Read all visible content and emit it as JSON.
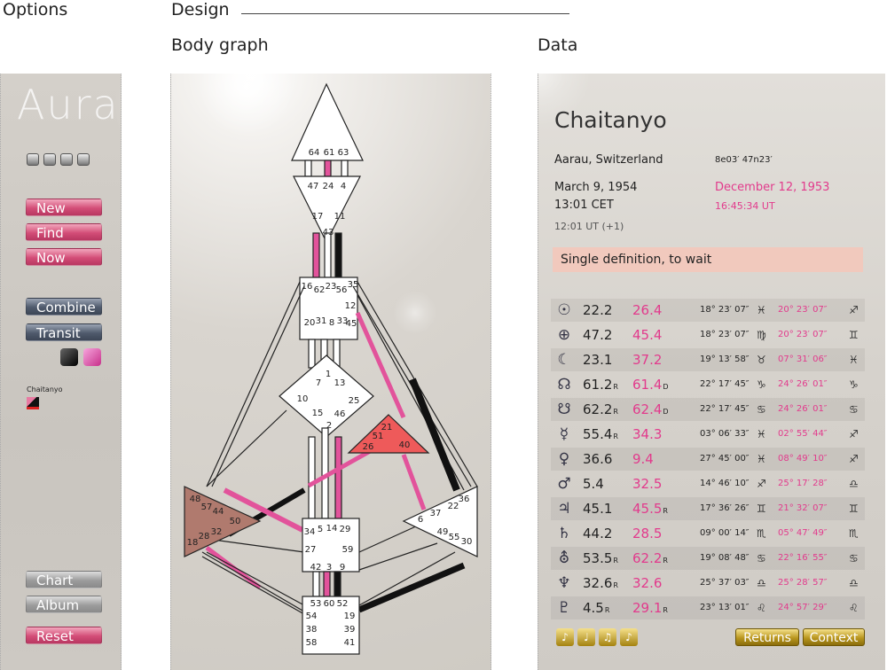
{
  "headers": {
    "options": "Options",
    "design": "Design",
    "bodygraph": "Body graph",
    "data": "Data"
  },
  "options": {
    "logo": "Auracircle",
    "buttons": {
      "new": "New",
      "find": "Find",
      "now": "Now",
      "combine": "Combine",
      "transit": "Transit",
      "chart": "Chart",
      "album": "Album",
      "reset": "Reset"
    },
    "person": "Chaitanyo"
  },
  "graph": {
    "gates": [
      "64",
      "61",
      "63",
      "47",
      "24",
      "4",
      "17",
      "11",
      "43",
      "16",
      "62",
      "23",
      "56",
      "35",
      "12",
      "20",
      "31",
      "8",
      "33",
      "45",
      "7",
      "1",
      "13",
      "10",
      "25",
      "15",
      "2",
      "46",
      "21",
      "51",
      "26",
      "40",
      "48",
      "57",
      "44",
      "50",
      "32",
      "28",
      "18",
      "6",
      "37",
      "22",
      "36",
      "49",
      "55",
      "30",
      "34",
      "5",
      "14",
      "29",
      "27",
      "59",
      "42",
      "3",
      "9",
      "53",
      "60",
      "52",
      "54",
      "19",
      "38",
      "39",
      "58",
      "41"
    ],
    "colors": {
      "design": "#e2539b",
      "personality": "#111111",
      "ego": "#ee5a5a",
      "spleen": "#b07a6e"
    }
  },
  "data": {
    "name": "Chaitanyo",
    "place": "Aarau, Switzerland",
    "coords": "8e03′ 47n23′",
    "personality": {
      "date": "March 9, 1954",
      "time": "13:01 CET",
      "ut": "12:01 UT (+1)"
    },
    "design": {
      "date": "December 12, 1953",
      "time": "16:45:34 UT"
    },
    "definition": "Single definition, to wait",
    "planets": [
      {
        "symbol": "☉",
        "p": "22.2",
        "psub": "",
        "d": "26.4",
        "dsub": "",
        "pdeg": "18° 23′ 07″",
        "pz": "♓",
        "ddeg": "20° 23′ 07″",
        "dz": "♐"
      },
      {
        "symbol": "⊕",
        "p": "47.2",
        "psub": "",
        "d": "45.4",
        "dsub": "",
        "pdeg": "18° 23′ 07″",
        "pz": "♍",
        "ddeg": "20° 23′ 07″",
        "dz": "♊"
      },
      {
        "symbol": "☾",
        "p": "23.1",
        "psub": "",
        "d": "37.2",
        "dsub": "",
        "pdeg": "19° 13′ 58″",
        "pz": "♉",
        "ddeg": "07° 31′ 06″",
        "dz": "♓"
      },
      {
        "symbol": "☊",
        "p": "61.2",
        "psub": "R",
        "d": "61.4",
        "dsub": "D",
        "pdeg": "22° 17′ 45″",
        "pz": "♑",
        "ddeg": "24° 26′ 01″",
        "dz": "♑"
      },
      {
        "symbol": "☋",
        "p": "62.2",
        "psub": "R",
        "d": "62.4",
        "dsub": "D",
        "pdeg": "22° 17′ 45″",
        "pz": "♋",
        "ddeg": "24° 26′ 01″",
        "dz": "♋"
      },
      {
        "symbol": "☿",
        "p": "55.4",
        "psub": "R",
        "d": "34.3",
        "dsub": "",
        "pdeg": "03° 06′ 33″",
        "pz": "♓",
        "ddeg": "02° 55′ 44″",
        "dz": "♐"
      },
      {
        "symbol": "♀",
        "p": "36.6",
        "psub": "",
        "d": "9.4",
        "dsub": "",
        "pdeg": "27° 45′ 00″",
        "pz": "♓",
        "ddeg": "08° 49′ 10″",
        "dz": "♐"
      },
      {
        "symbol": "♂",
        "p": "5.4",
        "psub": "",
        "d": "32.5",
        "dsub": "",
        "pdeg": "14° 46′ 10″",
        "pz": "♐",
        "ddeg": "25° 17′ 28″",
        "dz": "♎"
      },
      {
        "symbol": "♃",
        "p": "45.1",
        "psub": "",
        "d": "45.5",
        "dsub": "R",
        "pdeg": "17° 36′ 26″",
        "pz": "♊",
        "ddeg": "21° 32′ 07″",
        "dz": "♊"
      },
      {
        "symbol": "♄",
        "p": "44.2",
        "psub": "",
        "d": "28.5",
        "dsub": "",
        "pdeg": "09° 00′ 14″",
        "pz": "♏",
        "ddeg": "05° 47′ 49″",
        "dz": "♏"
      },
      {
        "symbol": "⛢",
        "p": "53.5",
        "psub": "R",
        "d": "62.2",
        "dsub": "R",
        "pdeg": "19° 08′ 48″",
        "pz": "♋",
        "ddeg": "22° 16′ 55″",
        "dz": "♋"
      },
      {
        "symbol": "♆",
        "p": "32.6",
        "psub": "R",
        "d": "32.6",
        "dsub": "",
        "pdeg": "25° 37′ 03″",
        "pz": "♎",
        "ddeg": "25° 28′ 57″",
        "dz": "♎"
      },
      {
        "symbol": "♇",
        "p": "4.5",
        "psub": "R",
        "d": "29.1",
        "dsub": "R",
        "pdeg": "23° 13′ 01″",
        "pz": "♌",
        "ddeg": "24° 57′ 29″",
        "dz": "♌"
      }
    ],
    "bottom_icons": [
      "♪",
      "♩",
      "♫",
      "♪"
    ],
    "buttons": {
      "returns": "Returns",
      "context": "Context"
    }
  }
}
